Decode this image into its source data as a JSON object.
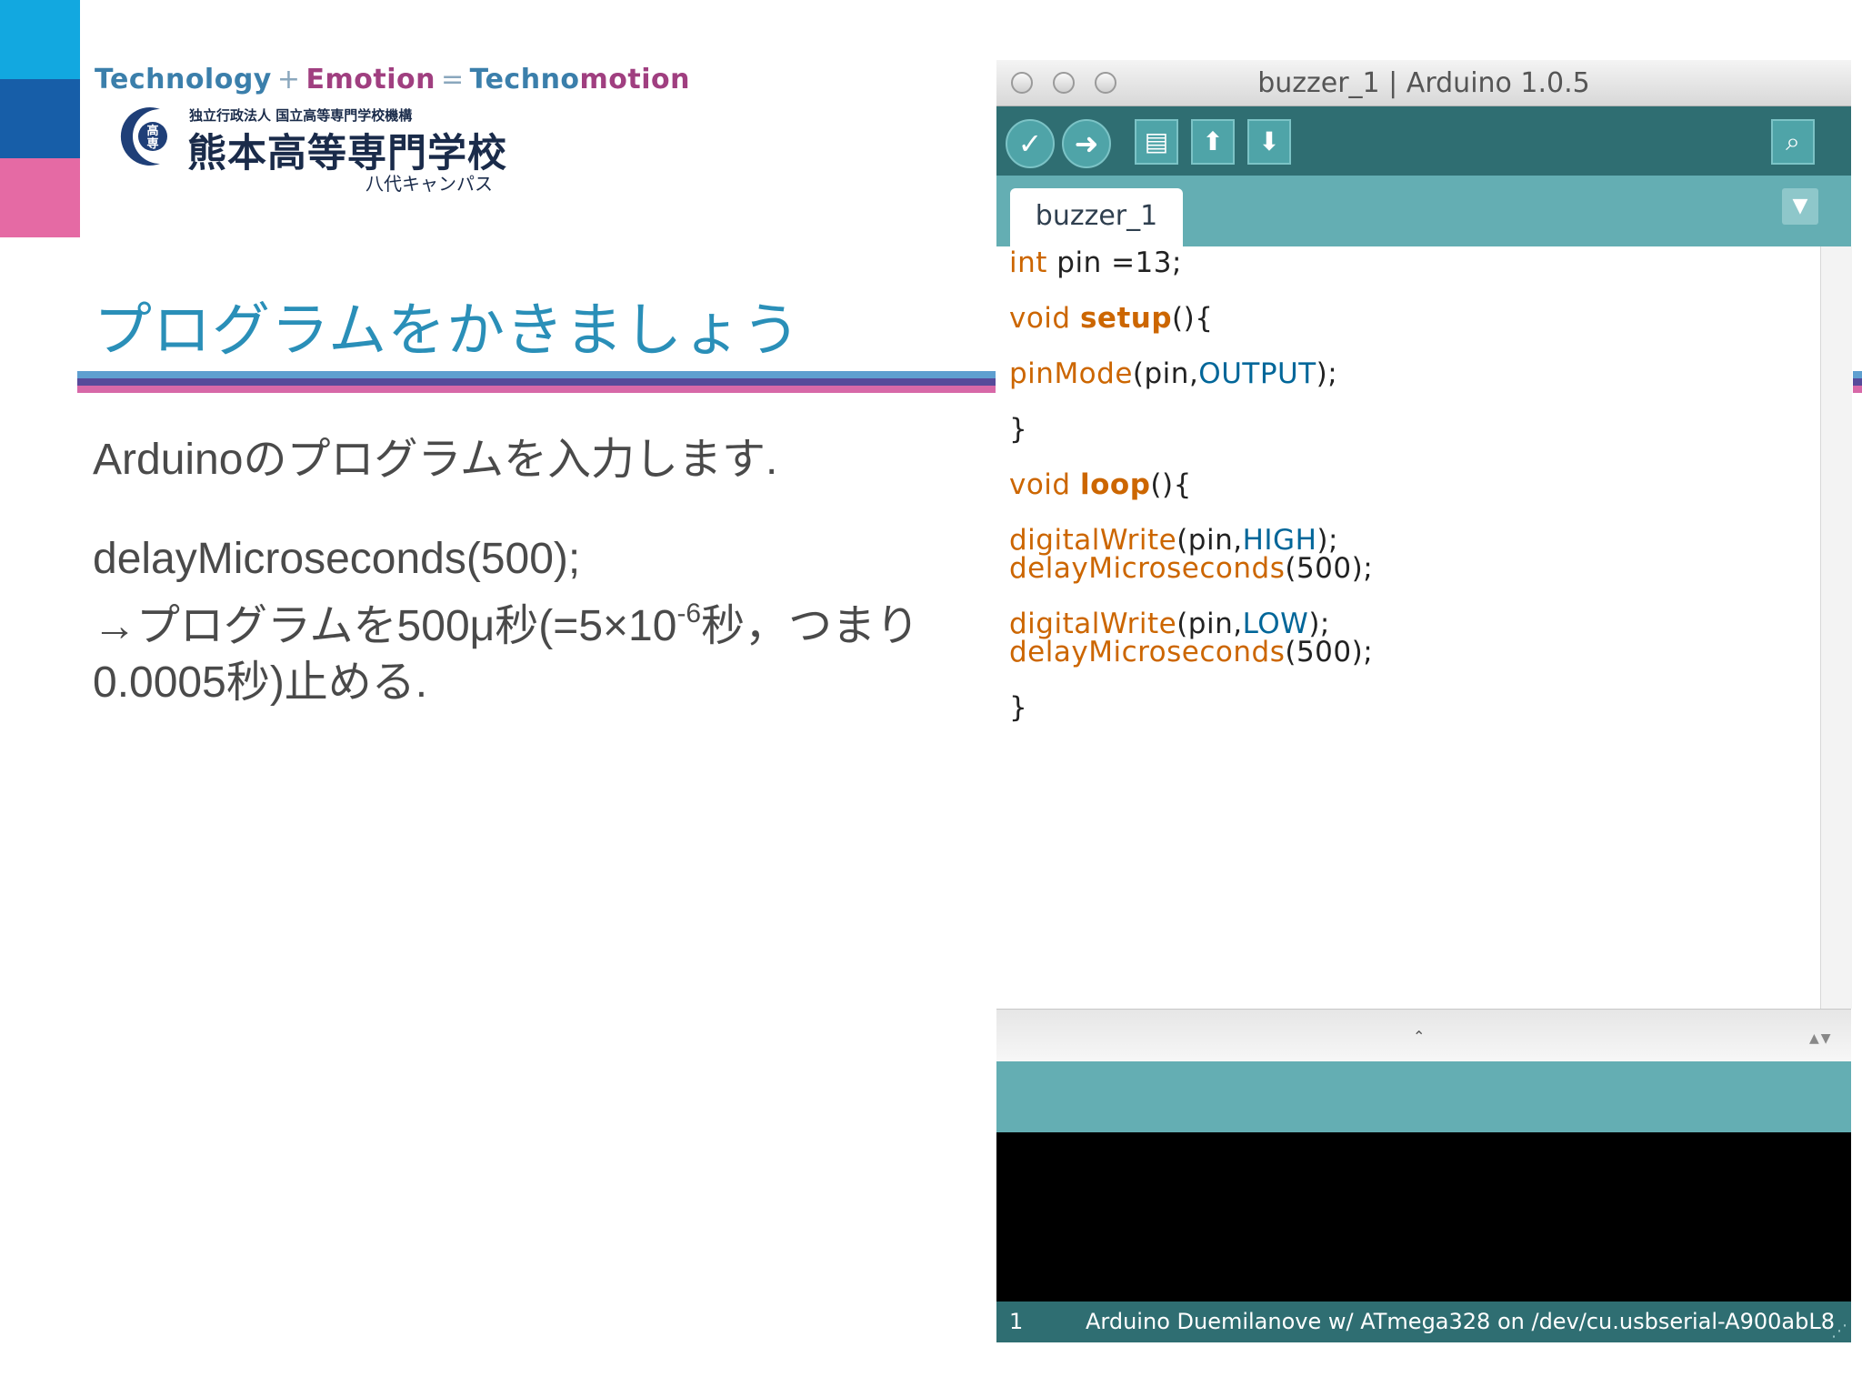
{
  "slide": {
    "tagline": {
      "part1": "Technology",
      "plus": "+",
      "part2": "Emotion",
      "equals": "=",
      "part3a": "Techno",
      "part3b": "motion"
    },
    "school": {
      "logo_mark": "高専",
      "org": "独立行政法人 国立高等専門学校機構",
      "name": "熊本高等専門学校",
      "campus": "八代キャンパス"
    },
    "title": "プログラムをかきましょう",
    "body": {
      "line1": "Arduinoのプログラムを入力します.",
      "line2": "delayMicroseconds(500);",
      "line3_pre": "→プログラムを500μ秒(=5×10",
      "line3_sup": "-6",
      "line3_post": "秒，つまり",
      "line4": "0.0005秒)止める."
    }
  },
  "ide": {
    "window_title": "buzzer_1 | Arduino 1.0.5",
    "toolbar": {
      "verify_icon": "check-icon",
      "upload_icon": "arrow-right-icon",
      "new_icon": "document-icon",
      "open_icon": "arrow-up-icon",
      "save_icon": "arrow-down-icon",
      "monitor_icon": "magnifier-icon"
    },
    "tab_label": "buzzer_1",
    "code": {
      "l1_kw": "int",
      "l1_rest": " pin =13;",
      "l2_kw": "void",
      "l2_fn": "setup",
      "l2_rest": "(){",
      "l3_fn": "pinMode",
      "l3_a": "(pin,",
      "l3_const": "OUTPUT",
      "l3_b": ");",
      "l4": "}",
      "l5_kw": "void",
      "l5_fn": "loop",
      "l5_rest": "(){",
      "l6_fn": "digitalWrite",
      "l6_a": "(pin,",
      "l6_const": "HIGH",
      "l6_b": ");",
      "l7_fn": "delayMicroseconds",
      "l7_rest": "(500);",
      "l8_fn": "digitalWrite",
      "l8_a": "(pin,",
      "l8_const": "LOW",
      "l8_b": ");",
      "l9_fn": "delayMicroseconds",
      "l9_rest": "(500);",
      "l10": "}"
    },
    "status": {
      "line_number": "1",
      "board": "Arduino Duemilanove w/ ATmega328 on /dev/cu.usbserial-A900abL8"
    }
  },
  "colors": {
    "accent_blue": "#2a8fb8",
    "ide_teal": "#64aeb3",
    "ide_dark_teal": "#2f6e72",
    "code_orange": "#cc6600",
    "code_blue": "#006699"
  }
}
